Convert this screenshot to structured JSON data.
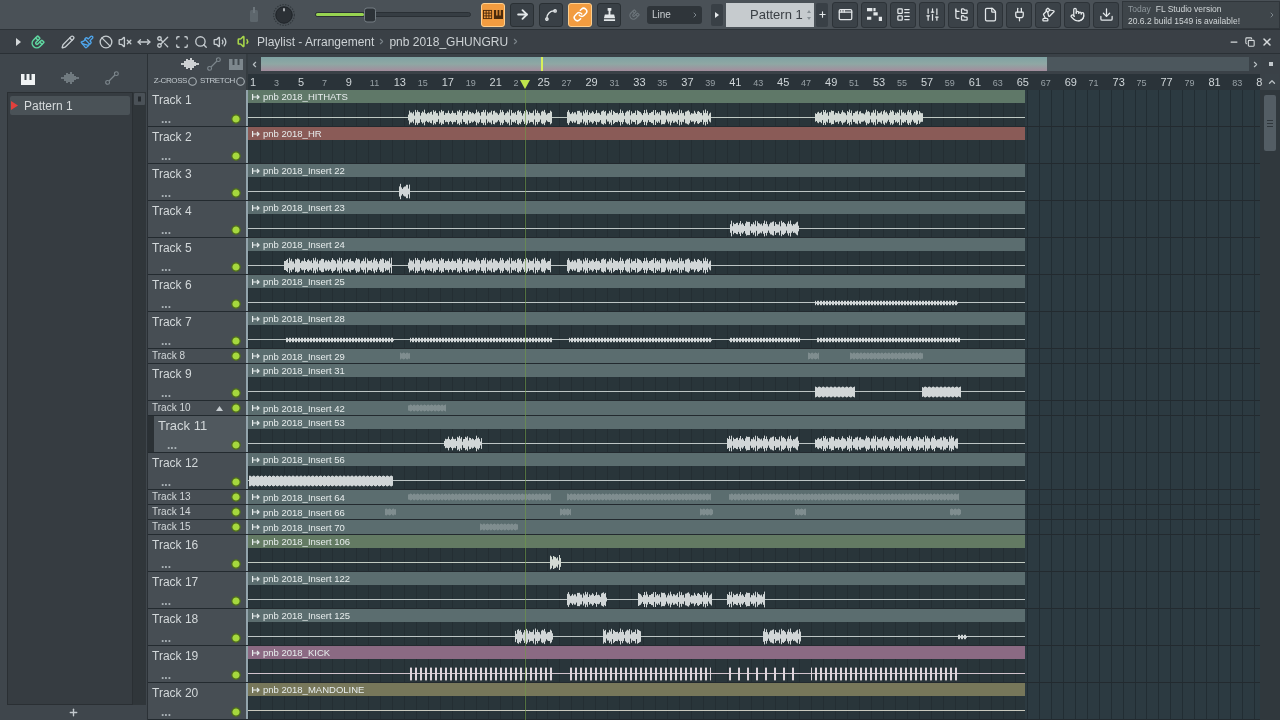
{
  "toolbar": {
    "master_volume": {
      "level": 0.35
    },
    "modes": [
      {
        "kind": "pattern-song",
        "on": true
      },
      {
        "kind": "arrow",
        "on": false
      },
      {
        "kind": "curve",
        "on": false
      },
      {
        "kind": "link",
        "on": true
      },
      {
        "kind": "stamp",
        "on": false
      }
    ],
    "snap": {
      "value": "Line"
    },
    "pattern": {
      "value": "Pattern 1"
    },
    "news": {
      "tag": "Today",
      "title": "FL Studio version",
      "message": "20.6.2 build 1549 is available!"
    }
  },
  "playlist": {
    "snap_on": true,
    "tools": [
      {
        "kind": "draw",
        "selected": false
      },
      {
        "kind": "paint",
        "selected": true
      },
      {
        "kind": "delete",
        "selected": false
      },
      {
        "kind": "mute",
        "selected": false
      },
      {
        "kind": "slip",
        "selected": false
      },
      {
        "kind": "slice",
        "selected": false
      },
      {
        "kind": "select",
        "selected": false
      },
      {
        "kind": "zoom",
        "selected": false
      },
      {
        "kind": "playback",
        "selected": false
      }
    ],
    "title": "Playlist - Arrangement",
    "arrangement": "pnb 2018_GHUNGRU"
  },
  "picker": {
    "tabs": [
      {
        "kind": "patterns",
        "selected": true
      },
      {
        "kind": "audio",
        "selected": false
      },
      {
        "kind": "automation",
        "selected": false
      }
    ],
    "items": [
      {
        "label": "Pattern 1",
        "selected": true
      }
    ]
  },
  "track_tools": {
    "filters": [
      {
        "kind": "audio",
        "selected": true
      },
      {
        "kind": "automation",
        "selected": false
      },
      {
        "kind": "patterns",
        "selected": false
      }
    ],
    "z_cross": {
      "label": "Z-CROSS",
      "checked": false
    },
    "stretch": {
      "label": "STRETCH",
      "checked": false
    }
  },
  "timeline": {
    "bars": [
      "1",
      "3",
      "5",
      "7",
      "9",
      "11",
      "13",
      "15",
      "17",
      "19",
      "21",
      "2",
      "25",
      "27",
      "29",
      "31",
      "33",
      "35",
      "37",
      "39",
      "41",
      "43",
      "45",
      "47",
      "49",
      "51",
      "53",
      "55",
      "57",
      "59",
      "61",
      "63",
      "65",
      "67",
      "69",
      "71",
      "73",
      "75",
      "77",
      "79",
      "81",
      "83",
      "8"
    ],
    "playhead": {
      "level": 0.274
    }
  },
  "tracks": [
    {
      "name": "Track 1",
      "kind": "tall",
      "more": "...",
      "on": true,
      "selected": false,
      "arrow": false,
      "clip": {
        "name": "pnb 2018_HITHATS",
        "color": "#5f7868"
      }
    },
    {
      "name": "Track 2",
      "kind": "tall",
      "more": "...",
      "on": true,
      "selected": false,
      "arrow": false,
      "clip": {
        "name": "pnb 2018_HR",
        "color": "#8a5b57"
      }
    },
    {
      "name": "Track 3",
      "kind": "tall",
      "more": "...",
      "on": true,
      "selected": false,
      "arrow": false,
      "clip": {
        "name": "pnb 2018_Insert 22",
        "color": "#5b6d6f"
      }
    },
    {
      "name": "Track 4",
      "kind": "tall",
      "more": "...",
      "on": true,
      "selected": false,
      "arrow": false,
      "clip": {
        "name": "pnb 2018_Insert 23",
        "color": "#5b6d6f"
      }
    },
    {
      "name": "Track 5",
      "kind": "tall",
      "more": "...",
      "on": true,
      "selected": false,
      "arrow": false,
      "clip": {
        "name": "pnb 2018_Insert 24",
        "color": "#5b6d6f"
      }
    },
    {
      "name": "Track 6",
      "kind": "tall",
      "more": "...",
      "on": true,
      "selected": false,
      "arrow": false,
      "clip": {
        "name": "pnb 2018_Insert 25",
        "color": "#5b6d6f"
      }
    },
    {
      "name": "Track 7",
      "kind": "tall",
      "more": "...",
      "on": true,
      "selected": false,
      "arrow": false,
      "clip": {
        "name": "pnb 2018_Insert 28",
        "color": "#5b6d6f"
      }
    },
    {
      "name": "Track 8",
      "kind": "small",
      "on": true,
      "selected": false,
      "arrow": false,
      "clip": {
        "name": "pnb 2018_Insert 29",
        "color": "#5b6d6f"
      }
    },
    {
      "name": "Track 9",
      "kind": "tall",
      "more": "...",
      "on": true,
      "selected": false,
      "arrow": false,
      "clip": {
        "name": "pnb 2018_Insert 31",
        "color": "#5b6d6f"
      }
    },
    {
      "name": "Track 10",
      "kind": "small",
      "on": true,
      "selected": false,
      "arrow": true,
      "clip": {
        "name": "pnb 2018_Insert 42",
        "color": "#5b6d6f"
      }
    },
    {
      "name": "Track 11",
      "kind": "tall",
      "more": "...",
      "on": true,
      "selected": true,
      "arrow": false,
      "clip": {
        "name": "pnb 2018_Insert 53",
        "color": "#5b6d6f"
      }
    },
    {
      "name": "Track 12",
      "kind": "tall",
      "more": "...",
      "on": true,
      "selected": false,
      "arrow": false,
      "clip": {
        "name": "pnb 2018_Insert 56",
        "color": "#5b6d6f"
      }
    },
    {
      "name": "Track 13",
      "kind": "small",
      "on": true,
      "selected": false,
      "arrow": false,
      "clip": {
        "name": "pnb 2018_Insert 64",
        "color": "#5b6d6f"
      }
    },
    {
      "name": "Track 14",
      "kind": "small",
      "on": true,
      "selected": false,
      "arrow": false,
      "clip": {
        "name": "pnb 2018_Insert 66",
        "color": "#5b6d6f"
      }
    },
    {
      "name": "Track 15",
      "kind": "small",
      "on": true,
      "selected": false,
      "arrow": false,
      "clip": {
        "name": "pnb 2018_Insert 70",
        "color": "#5b6d6f"
      }
    },
    {
      "name": "Track 16",
      "kind": "tall",
      "more": "...",
      "on": true,
      "selected": false,
      "arrow": false,
      "clip": {
        "name": "pnb 2018_Insert 106",
        "color": "#637a63"
      }
    },
    {
      "name": "Track 17",
      "kind": "tall",
      "more": "...",
      "on": true,
      "selected": false,
      "arrow": false,
      "clip": {
        "name": "pnb 2018_Insert 122",
        "color": "#5b6d6f"
      }
    },
    {
      "name": "Track 18",
      "kind": "tall",
      "more": "...",
      "on": true,
      "selected": false,
      "arrow": false,
      "clip": {
        "name": "pnb 2018_Insert 125",
        "color": "#5b6d6f"
      }
    },
    {
      "name": "Track 19",
      "kind": "tall",
      "more": "...",
      "on": true,
      "selected": false,
      "arrow": false,
      "clip": {
        "name": "pnb 2018_KICK",
        "color": "#8b6a83"
      }
    },
    {
      "name": "Track 20",
      "kind": "tall",
      "more": "...",
      "on": true,
      "selected": false,
      "arrow": false,
      "clip": {
        "name": "pnb 2018_MANDOLINE",
        "color": "#77775a"
      }
    }
  ]
}
